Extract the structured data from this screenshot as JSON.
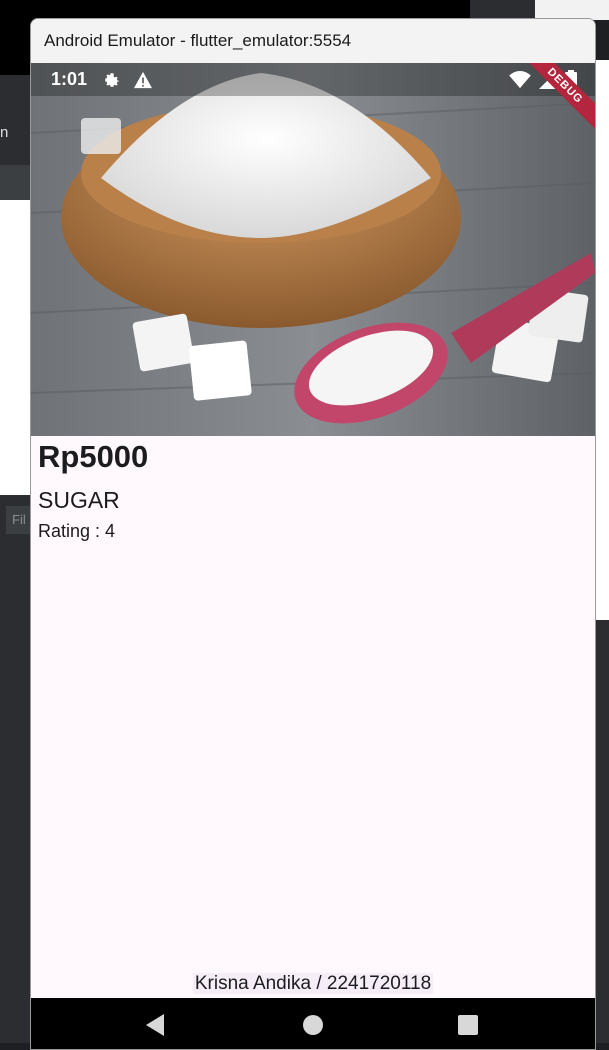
{
  "window": {
    "title": "Android Emulator - flutter_emulator:5554"
  },
  "background": {
    "left_fragment": "n",
    "filter_fragment": "Fil"
  },
  "status_bar": {
    "time": "1:01",
    "debug_label": "DEBUG"
  },
  "product": {
    "image_alt": "Bowl of sugar with sugar cubes and a red scoop",
    "price": "Rp5000",
    "name": "SUGAR",
    "rating": "Rating : 4"
  },
  "footer": {
    "credit": "Krisna Andika / 2241720118"
  },
  "icons": {
    "status": [
      "gear-icon",
      "warning-icon",
      "wifi-icon",
      "signal-icon",
      "battery-icon"
    ],
    "nav": [
      "back-icon",
      "home-icon",
      "recents-icon"
    ]
  }
}
